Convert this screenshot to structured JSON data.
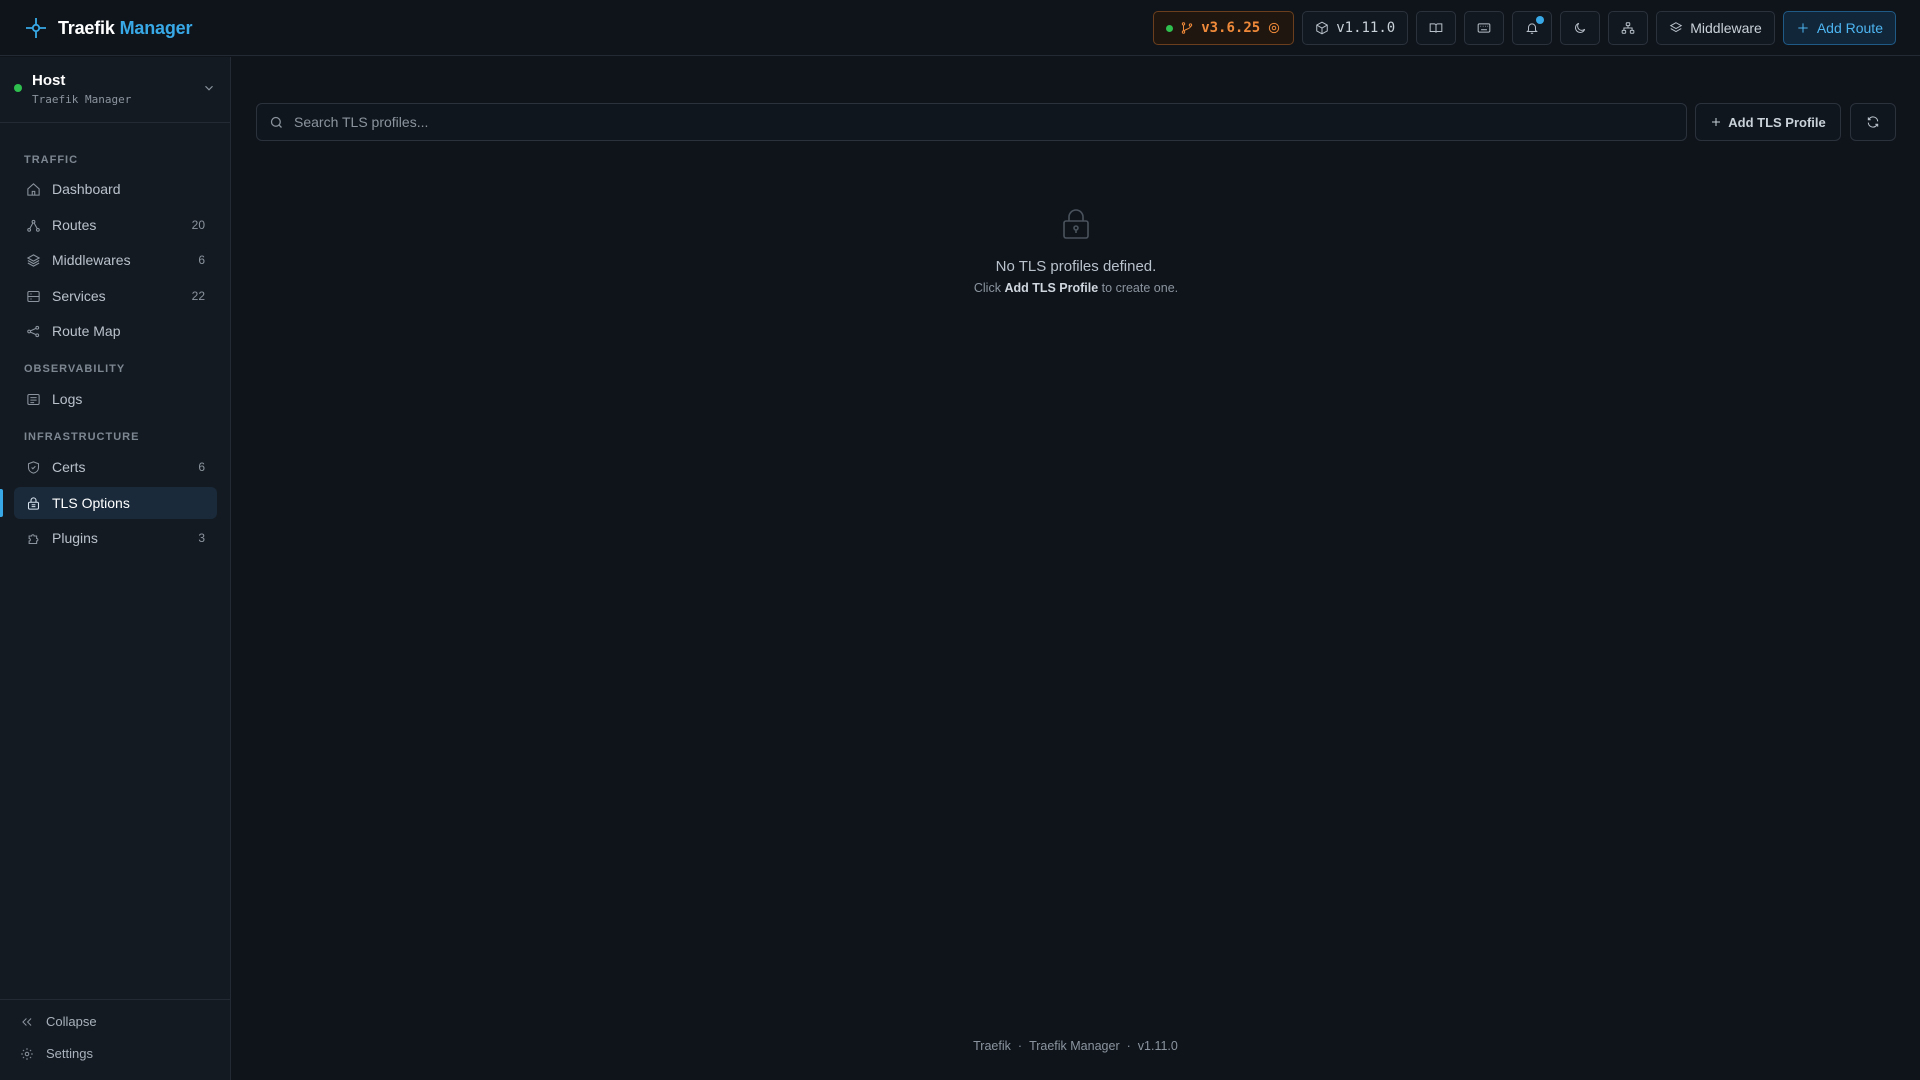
{
  "app": {
    "brand_primary": "Traefik",
    "brand_accent": "Manager",
    "accent_color": "#38a9e6"
  },
  "topbar": {
    "traefik_version": "v3.6.25",
    "manager_version": "v1.11.0",
    "icons": [
      "book-icon",
      "keyboard-icon",
      "bell-icon",
      "moon-icon",
      "network-icon"
    ],
    "middleware_label": "Middleware",
    "add_route_label": "Add Route"
  },
  "sidebar": {
    "host": {
      "title": "Host",
      "subtitle": "Traefik Manager",
      "status_color": "#2fbf4f"
    },
    "sections": [
      {
        "label": "TRAFFIC"
      },
      {
        "label": "OBSERVABILITY"
      },
      {
        "label": "INFRASTRUCTURE"
      }
    ],
    "items": [
      {
        "label": "Dashboard",
        "count": "",
        "icon": "home-icon"
      },
      {
        "label": "Routes",
        "count": "20",
        "icon": "routes-icon"
      },
      {
        "label": "Middlewares",
        "count": "6",
        "icon": "layers-icon"
      },
      {
        "label": "Services",
        "count": "22",
        "icon": "server-icon"
      },
      {
        "label": "Route Map",
        "count": "",
        "icon": "map-icon"
      },
      {
        "label": "Logs",
        "count": "",
        "icon": "logs-icon"
      },
      {
        "label": "Certs",
        "count": "6",
        "icon": "shield-check-icon"
      },
      {
        "label": "TLS Options",
        "count": "",
        "icon": "lock-icon",
        "active": true
      },
      {
        "label": "Plugins",
        "count": "3",
        "icon": "puzzle-icon"
      }
    ],
    "bottom": {
      "collapse_label": "Collapse",
      "settings_label": "Settings"
    }
  },
  "main": {
    "search": {
      "placeholder": "Search TLS profiles...",
      "value": ""
    },
    "add_button_label": "Add TLS Profile",
    "empty": {
      "title": "No TLS profiles defined.",
      "hint_prefix": "Click",
      "hint_strong": "Add TLS Profile",
      "hint_suffix": "to create one."
    }
  },
  "footer": {
    "part1": "Traefik",
    "part2": "Traefik Manager",
    "part3": "v1.11.0",
    "separator": "·"
  }
}
